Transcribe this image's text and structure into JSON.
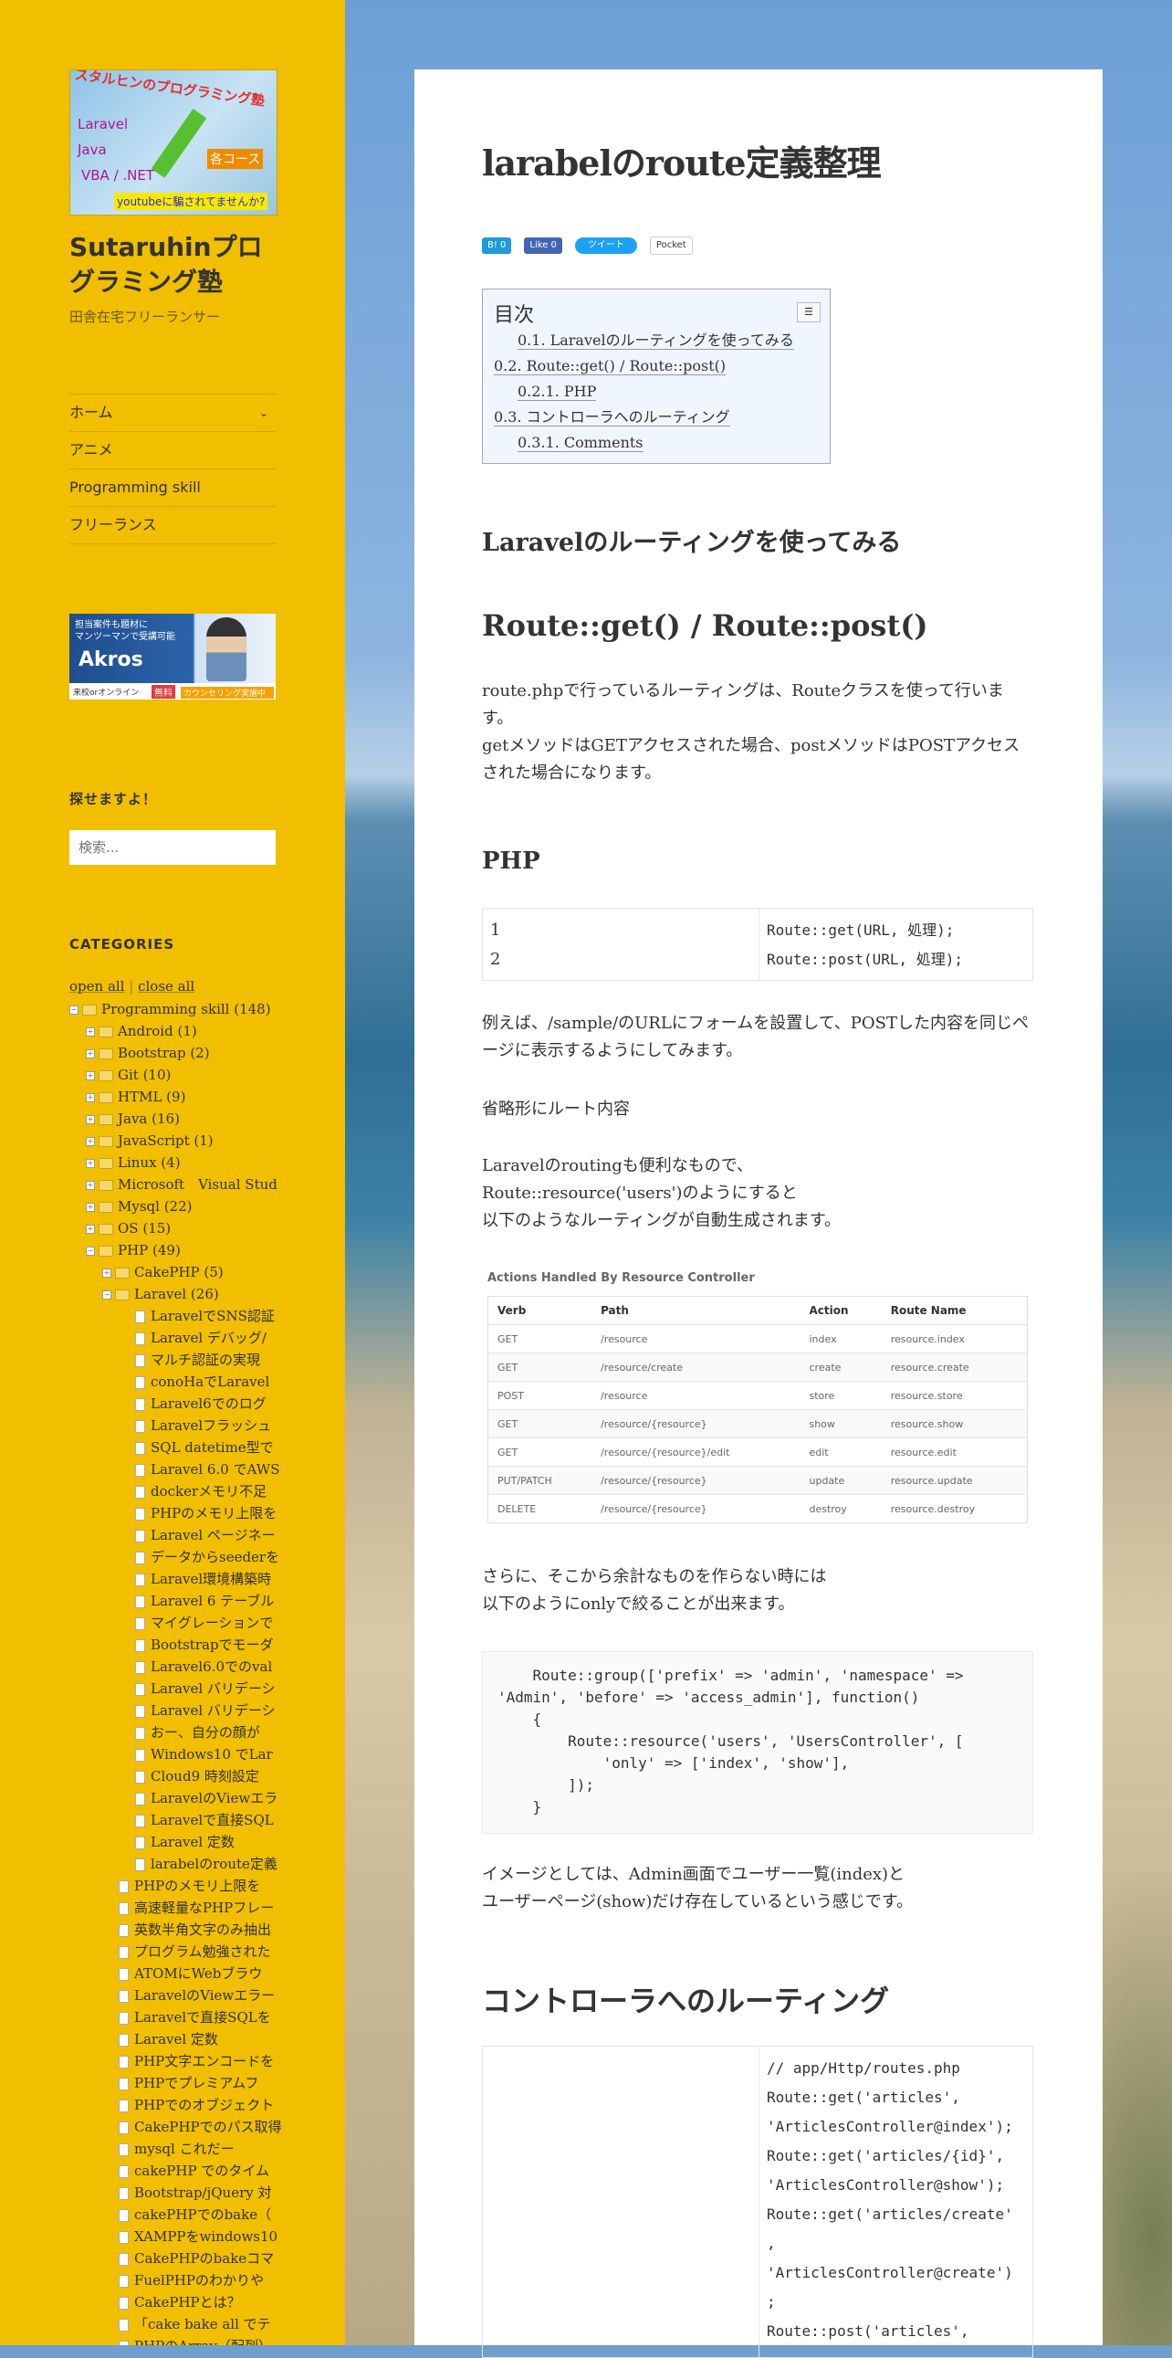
{
  "sidebar": {
    "logo": {
      "lines": [
        "スタルヒンのプログラミング塾",
        "Laravel",
        "Java",
        "VBA / .NET",
        "各コース",
        "youtubeに騙されてませんか?"
      ]
    },
    "site_title": "Sutaruhinプログラミング塾",
    "site_description": "田舎在宅フリーランサー",
    "menu": [
      {
        "label": "ホーム"
      },
      {
        "label": "アニメ"
      },
      {
        "label": "Programming skill"
      },
      {
        "label": "フリーランス"
      }
    ],
    "ad": {
      "line1": "担当案件も題材に",
      "line2": "マンツーマンで受講可能",
      "brand": "Akros",
      "bottom_left": "来校orオンライン",
      "badge": "無料",
      "cta": "カウンセリング実施中"
    },
    "search_title": "探せますよ！",
    "search_placeholder": "検索...",
    "categories_title": "CATEGORIES",
    "open_all": "open all",
    "separator": "|",
    "close_all": "close all",
    "tree": [
      {
        "depth": 0,
        "kind": "folder-open",
        "label": "Programming skill (148)"
      },
      {
        "depth": 1,
        "kind": "folder",
        "label": "Android (1)"
      },
      {
        "depth": 1,
        "kind": "folder",
        "label": "Bootstrap (2)"
      },
      {
        "depth": 1,
        "kind": "folder",
        "label": "Git (10)"
      },
      {
        "depth": 1,
        "kind": "folder",
        "label": "HTML (9)"
      },
      {
        "depth": 1,
        "kind": "folder",
        "label": "Java (16)"
      },
      {
        "depth": 1,
        "kind": "folder",
        "label": "JavaScript (1)"
      },
      {
        "depth": 1,
        "kind": "folder",
        "label": "Linux (4)"
      },
      {
        "depth": 1,
        "kind": "folder",
        "label": "Microsoft　Visual Stud"
      },
      {
        "depth": 1,
        "kind": "folder",
        "label": "Mysql (22)"
      },
      {
        "depth": 1,
        "kind": "folder",
        "label": "OS (15)"
      },
      {
        "depth": 1,
        "kind": "folder-open",
        "label": "PHP (49)"
      },
      {
        "depth": 2,
        "kind": "folder",
        "label": "CakePHP (5)"
      },
      {
        "depth": 2,
        "kind": "folder-open",
        "label": "Laravel (26)"
      },
      {
        "depth": 3,
        "kind": "file",
        "label": "LaravelでSNS認証"
      },
      {
        "depth": 3,
        "kind": "file",
        "label": "Laravel デバッグ/"
      },
      {
        "depth": 3,
        "kind": "file",
        "label": "マルチ認証の実現"
      },
      {
        "depth": 3,
        "kind": "file",
        "label": "conoHaでLaravel"
      },
      {
        "depth": 3,
        "kind": "file",
        "label": "Laravel6でのログ"
      },
      {
        "depth": 3,
        "kind": "file",
        "label": "Laravelフラッシュ"
      },
      {
        "depth": 3,
        "kind": "file",
        "label": "SQL datetime型で"
      },
      {
        "depth": 3,
        "kind": "file",
        "label": "Laravel 6.0 でAWS"
      },
      {
        "depth": 3,
        "kind": "file",
        "label": "dockerメモリ不足"
      },
      {
        "depth": 3,
        "kind": "file",
        "label": "PHPのメモリ上限を"
      },
      {
        "depth": 3,
        "kind": "file",
        "label": "Laravel ページネー"
      },
      {
        "depth": 3,
        "kind": "file",
        "label": "データからseederを"
      },
      {
        "depth": 3,
        "kind": "file",
        "label": "Laravel環境構築時"
      },
      {
        "depth": 3,
        "kind": "file",
        "label": "Laravel 6 テーブル"
      },
      {
        "depth": 3,
        "kind": "file",
        "label": "マイグレーションで"
      },
      {
        "depth": 3,
        "kind": "file",
        "label": "Bootstrapでモーダ"
      },
      {
        "depth": 3,
        "kind": "file",
        "label": "Laravel6.0でのval"
      },
      {
        "depth": 3,
        "kind": "file",
        "label": "Laravel バリデーシ"
      },
      {
        "depth": 3,
        "kind": "file",
        "label": "Laravel バリデーシ"
      },
      {
        "depth": 3,
        "kind": "file",
        "label": "おー、自分の顔が"
      },
      {
        "depth": 3,
        "kind": "file",
        "label": "Windows10 でLar"
      },
      {
        "depth": 3,
        "kind": "file",
        "label": "Cloud9 時刻設定"
      },
      {
        "depth": 3,
        "kind": "file",
        "label": "LaravelのViewエラ"
      },
      {
        "depth": 3,
        "kind": "file",
        "label": "Laravelで直接SQL"
      },
      {
        "depth": 3,
        "kind": "file",
        "label": "Laravel 定数"
      },
      {
        "depth": 3,
        "kind": "file",
        "label": "larabelのroute定義"
      },
      {
        "depth": 2,
        "kind": "file",
        "label": "PHPのメモリ上限を"
      },
      {
        "depth": 2,
        "kind": "file",
        "label": "高速軽量なPHPフレー"
      },
      {
        "depth": 2,
        "kind": "file",
        "label": "英数半角文字のみ抽出"
      },
      {
        "depth": 2,
        "kind": "file",
        "label": "プログラム勉強された"
      },
      {
        "depth": 2,
        "kind": "file",
        "label": "ATOMにWebブラウ"
      },
      {
        "depth": 2,
        "kind": "file",
        "label": "LaravelのViewエラー"
      },
      {
        "depth": 2,
        "kind": "file",
        "label": "Laravelで直接SQLを"
      },
      {
        "depth": 2,
        "kind": "file",
        "label": "Laravel 定数"
      },
      {
        "depth": 2,
        "kind": "file",
        "label": "PHP文字エンコードを"
      },
      {
        "depth": 2,
        "kind": "file",
        "label": "PHPでプレミアムフ"
      },
      {
        "depth": 2,
        "kind": "file",
        "label": "PHPでのオブジェクト"
      },
      {
        "depth": 2,
        "kind": "file",
        "label": "CakePHPでのパス取得"
      },
      {
        "depth": 2,
        "kind": "file",
        "label": "mysql これだー"
      },
      {
        "depth": 2,
        "kind": "file",
        "label": "cakePHP でのタイム"
      },
      {
        "depth": 2,
        "kind": "file",
        "label": "Bootstrap/jQuery 対"
      },
      {
        "depth": 2,
        "kind": "file",
        "label": "cakePHPでのbake（"
      },
      {
        "depth": 2,
        "kind": "file",
        "label": "XAMPPをwindows10"
      },
      {
        "depth": 2,
        "kind": "file",
        "label": "CakePHPのbakeコマ"
      },
      {
        "depth": 2,
        "kind": "file",
        "label": "FuelPHPのわかりや"
      },
      {
        "depth": 2,
        "kind": "file",
        "label": "CakePHPとは？"
      },
      {
        "depth": 2,
        "kind": "file",
        "label": "「cake bake all でテ"
      },
      {
        "depth": 2,
        "kind": "file",
        "label": "PHPのArray（配列）"
      }
    ]
  },
  "article": {
    "title": "larabelのroute定義整理",
    "share": [
      {
        "label": "B! 0",
        "color": "#1d9bd9"
      },
      {
        "label": "Like 0",
        "color": "#4267b2"
      },
      {
        "label": "ツイート",
        "color": "#1da1f2"
      },
      {
        "label": "Pocket",
        "color": "#ef4056"
      }
    ],
    "toc": {
      "heading": "目次",
      "toggle": "☰",
      "items": [
        {
          "label": "0.1. Laravelのルーティングを使ってみる",
          "indent": 1
        },
        {
          "label": "0.2. Route::get() / Route::post()",
          "indent": 0
        },
        {
          "label": "0.2.1. PHP",
          "indent": 1
        },
        {
          "label": "0.3. コントローラへのルーティング",
          "indent": 0
        },
        {
          "label": "0.3.1. Comments",
          "indent": 1
        }
      ]
    },
    "h_laravel_routing": "Laravelのルーティングを使ってみる",
    "h_route_get": "Route::get() / Route::post()",
    "p_route_intro_1": "route.phpで行っているルーティングは、Routeクラスを使って行います。",
    "p_route_intro_2": "getメソッドはGETアクセスされた場合、postメソッドはPOSTアクセスされた場合になります。",
    "h_php": "PHP",
    "code1_lines": "1\n2",
    "code1": "Route::get(URL, 処理);\nRoute::post(URL, 処理);",
    "p_example": "例えば、/sample/のURLにフォームを設置して、POSTした内容を同じページに表示するようにしてみます。",
    "p_omit": "省略形にルート内容",
    "p_resource_1": "Laravelのroutingも便利なもので、",
    "p_resource_2": "Route::resource('users')のようにすると",
    "p_resource_3": "以下のようなルーティングが自動生成されます。",
    "resource_table": {
      "caption": "Actions Handled By Resource Controller",
      "headers": [
        "Verb",
        "Path",
        "Action",
        "Route Name"
      ],
      "rows": [
        [
          "GET",
          "/resource",
          "index",
          "resource.index"
        ],
        [
          "GET",
          "/resource/create",
          "create",
          "resource.create"
        ],
        [
          "POST",
          "/resource",
          "store",
          "resource.store"
        ],
        [
          "GET",
          "/resource/{resource}",
          "show",
          "resource.show"
        ],
        [
          "GET",
          "/resource/{resource}/edit",
          "edit",
          "resource.edit"
        ],
        [
          "PUT/PATCH",
          "/resource/{resource}",
          "update",
          "resource.update"
        ],
        [
          "DELETE",
          "/resource/{resource}",
          "destroy",
          "resource.destroy"
        ]
      ]
    },
    "p_only_1": "さらに、そこから余計なものを作らない時には",
    "p_only_2": "以下のようにonlyで絞ることが出来ます。",
    "code2": "    Route::group(['prefix' => 'admin', 'namespace' =>\n'Admin', 'before' => 'access_admin'], function()\n    {\n        Route::resource('users', 'UsersController', [\n            'only' => ['index', 'show'],\n        ]);\n    }",
    "p_image_1": "イメージとしては、Admin画面でユーザー一覧(index)と",
    "p_image_2": "ユーザーページ(show)だけ存在しているという感じです。",
    "h_controller": "コントローラへのルーティング",
    "code3": "// app/Http/routes.php\nRoute::get('articles',\n'ArticlesController@index');\nRoute::get('articles/{id}',\n'ArticlesController@show');\nRoute::get('articles/create'\n,\n'ArticlesController@create')\n;\nRoute::post('articles',"
  }
}
